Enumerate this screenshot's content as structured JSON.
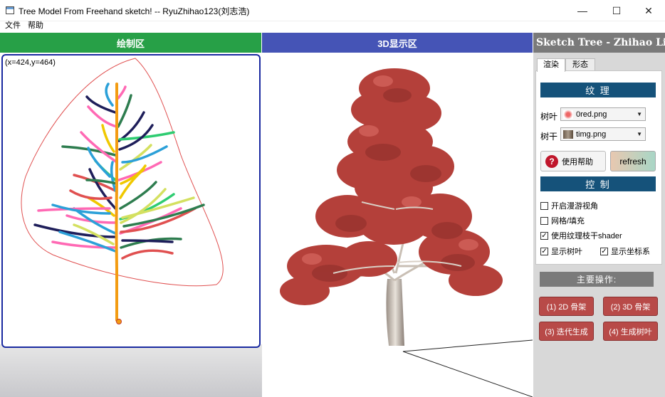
{
  "window": {
    "title": "Tree Model From Freehand sketch! -- RyuZhihao123(刘志浩)",
    "minimize": "—",
    "maximize": "☐",
    "close": "✕"
  },
  "menu": {
    "items": [
      "文件",
      "帮助"
    ]
  },
  "draw_panel": {
    "header": "绘制区",
    "coords": "(x=424,y=464)"
  },
  "view3d_panel": {
    "header": "3D显示区"
  },
  "side_panel": {
    "header": "Sketch Tree - Zhihao Liu",
    "tabs": [
      "渲染",
      "形态"
    ],
    "texture_section": "纹 理",
    "leaf_label": "树叶",
    "leaf_value": "0red.png",
    "trunk_label": "树干",
    "trunk_value": "timg.png",
    "help_button": "使用帮助",
    "refresh_button": "refresh",
    "control_section": "控 制",
    "checks": {
      "roam": {
        "label": "开启漫游视角",
        "checked": false
      },
      "mesh": {
        "label": "网格/填充",
        "checked": false
      },
      "shader": {
        "label": "使用纹理枝干shader",
        "checked": true
      },
      "leaves": {
        "label": "显示树叶",
        "checked": true
      },
      "axes": {
        "label": "显示坐标系",
        "checked": true
      }
    },
    "ops_title": "主要操作:",
    "ops": [
      "(1) 2D 骨架",
      "(2) 3D 骨架",
      "(3) 迭代生成",
      "(4) 生成树叶"
    ]
  },
  "colors": {
    "draw_header": "#27a047",
    "view_header": "#4554b6",
    "side_header": "#7a7a7a",
    "section_bar": "#15527a",
    "op_button": "#b84a48",
    "foliage": "#b4403a",
    "trunk": "#f39c12"
  }
}
